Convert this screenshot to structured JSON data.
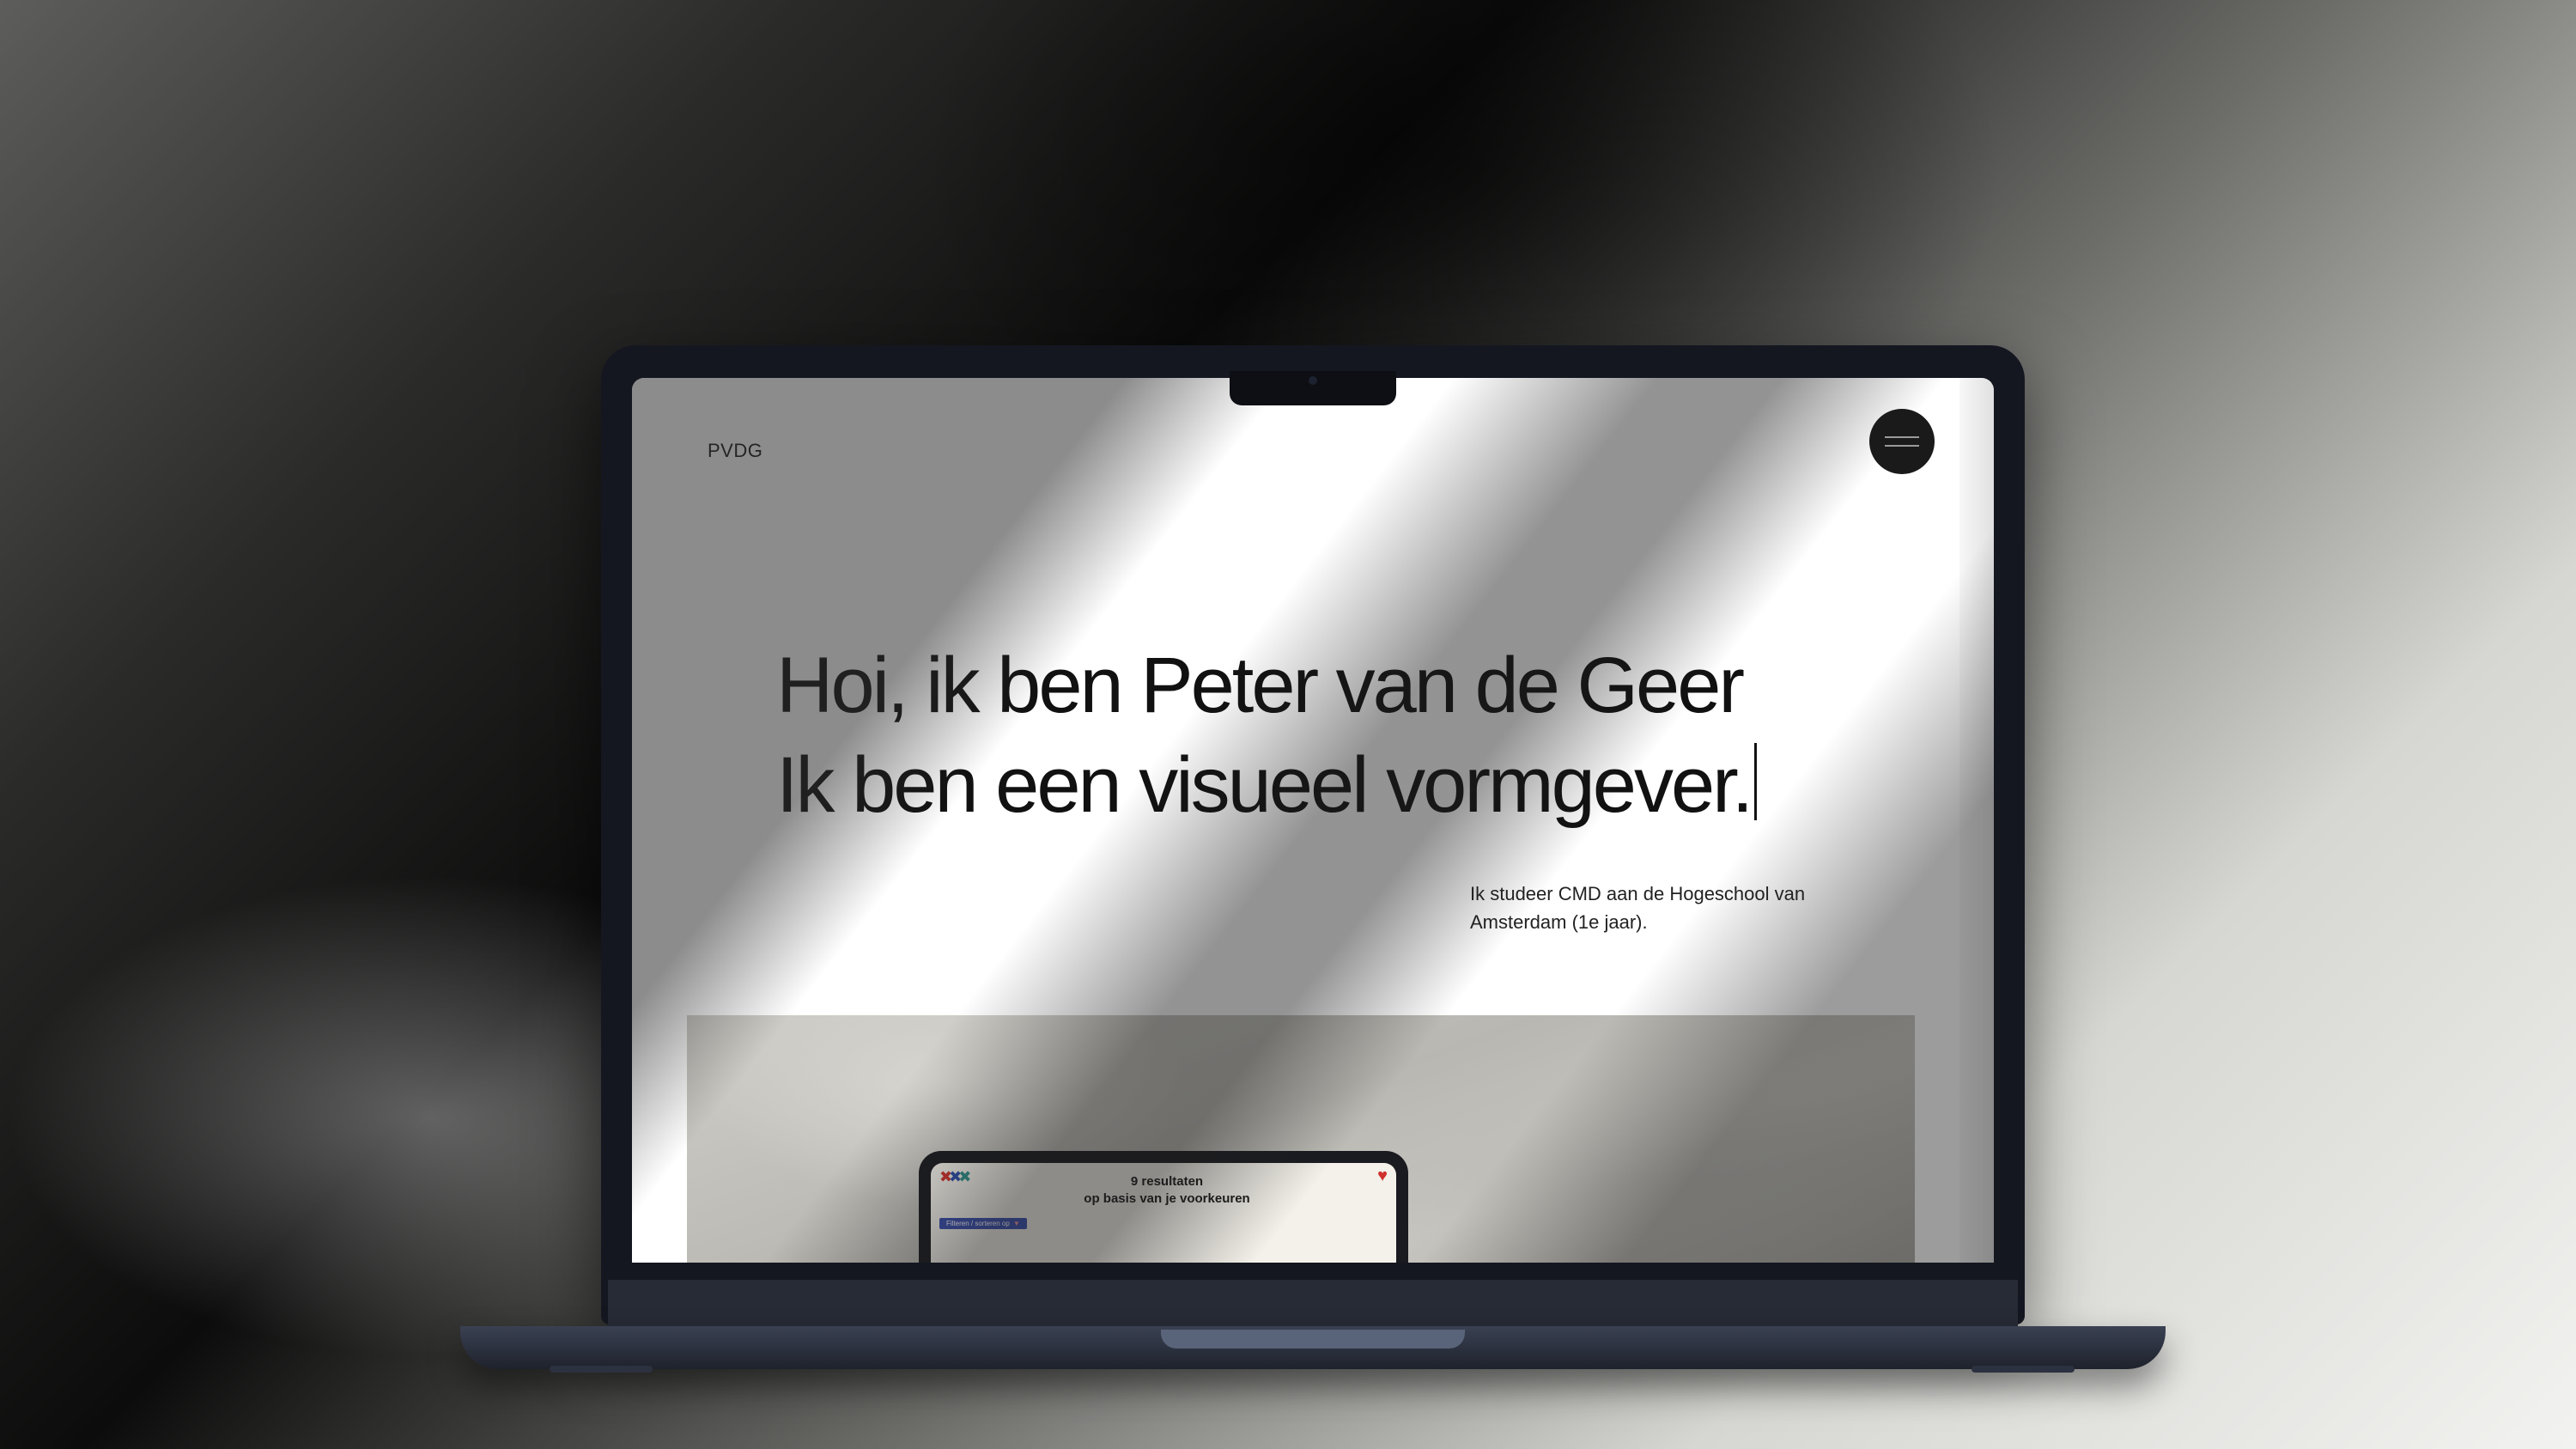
{
  "site": {
    "logo": "PVDG"
  },
  "hero": {
    "line1": "Hoi, ik ben Peter van de Geer",
    "line2": "Ik ben een visueel vormgever.",
    "subtitle": "Ik studeer CMD aan de Hogeschool van Amsterdam (1e jaar)."
  },
  "project_preview": {
    "result_count": "9 resultaten",
    "result_caption": "op basis van je voorkeuren",
    "filter_label": "Filteren / sorteren op"
  },
  "icons": {
    "menu": "hamburger-menu-icon",
    "favorite": "heart-icon",
    "app_logo": "x-logo-icon"
  }
}
